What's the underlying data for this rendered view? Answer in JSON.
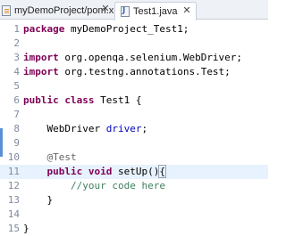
{
  "tabs": [
    {
      "label": "myDemoProject/pom.xml",
      "icon": "xml-file-icon"
    },
    {
      "label": "Test1.java",
      "icon": "java-file-icon"
    }
  ],
  "editor": {
    "current_line": 11,
    "lines": [
      {
        "n": "1",
        "tokens": [
          {
            "t": "package",
            "c": "kw"
          },
          {
            "t": " myDemoProject_Test1;",
            "c": ""
          }
        ]
      },
      {
        "n": "2",
        "tokens": []
      },
      {
        "n": "3",
        "tokens": [
          {
            "t": "import",
            "c": "kw"
          },
          {
            "t": " org.openqa.selenium.WebDriver;",
            "c": ""
          }
        ]
      },
      {
        "n": "4",
        "tokens": [
          {
            "t": "import",
            "c": "kw"
          },
          {
            "t": " org.testng.annotations.Test;",
            "c": ""
          }
        ]
      },
      {
        "n": "5",
        "tokens": []
      },
      {
        "n": "6",
        "tokens": [
          {
            "t": "public",
            "c": "kw"
          },
          {
            "t": " ",
            "c": ""
          },
          {
            "t": "class",
            "c": "kw"
          },
          {
            "t": " Test1 {",
            "c": ""
          }
        ]
      },
      {
        "n": "7",
        "tokens": []
      },
      {
        "n": "8",
        "tokens": [
          {
            "t": "    WebDriver ",
            "c": ""
          },
          {
            "t": "driver",
            "c": "fld"
          },
          {
            "t": ";",
            "c": ""
          }
        ]
      },
      {
        "n": "9",
        "tokens": []
      },
      {
        "n": "10",
        "tokens": [
          {
            "t": "    ",
            "c": ""
          },
          {
            "t": "@Test",
            "c": "ann"
          }
        ]
      },
      {
        "n": "11",
        "tokens": [
          {
            "t": "    ",
            "c": ""
          },
          {
            "t": "public",
            "c": "kw"
          },
          {
            "t": " ",
            "c": ""
          },
          {
            "t": "void",
            "c": "kw"
          },
          {
            "t": " setUp()",
            "c": ""
          },
          {
            "t": "{",
            "c": "bracket"
          },
          {
            "t": "",
            "c": "caret"
          }
        ]
      },
      {
        "n": "12",
        "tokens": [
          {
            "t": "        ",
            "c": ""
          },
          {
            "t": "//your code here",
            "c": "cmt"
          }
        ]
      },
      {
        "n": "13",
        "tokens": [
          {
            "t": "    ",
            "c": ""
          },
          {
            "t": "}",
            "c": ""
          }
        ]
      },
      {
        "n": "14",
        "tokens": []
      },
      {
        "n": "15",
        "tokens": [
          {
            "t": "}",
            "c": ""
          }
        ]
      }
    ]
  }
}
